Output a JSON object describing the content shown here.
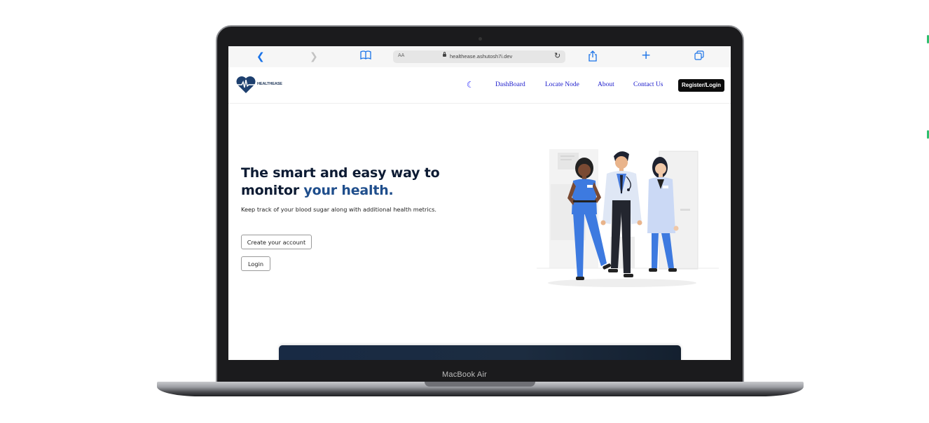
{
  "device": {
    "label": "MacBook Air"
  },
  "browser": {
    "aa_label": "AA",
    "url": "healthease.ashutosh7i.dev"
  },
  "site": {
    "logo_text": "HEALTHEASE",
    "nav": {
      "dashboard": "DashBoard",
      "locate_node": "Locate Node",
      "about": "About",
      "contact": "Contact Us",
      "register_login": "Register/Login"
    },
    "hero": {
      "title_line1": "The smart and easy way to",
      "title_line2_prefix": "monitor ",
      "title_line2_accent": "your health.",
      "subtitle": "Keep track of your blood sugar along with additional health metrics.",
      "create_account": "Create your account",
      "login": "Login"
    }
  },
  "colors": {
    "accent_blue": "#1f4e8c",
    "nav_link": "#1a1acc",
    "register_bg": "#0b0b0b",
    "toolbar_icon": "#1a73e8"
  },
  "icons": [
    "back-arrow-icon",
    "forward-arrow-icon",
    "bookmarks-icon",
    "lock-icon",
    "reload-icon",
    "share-icon",
    "new-tab-icon",
    "tabs-icon",
    "heart-pulse-logo-icon",
    "moon-icon"
  ]
}
